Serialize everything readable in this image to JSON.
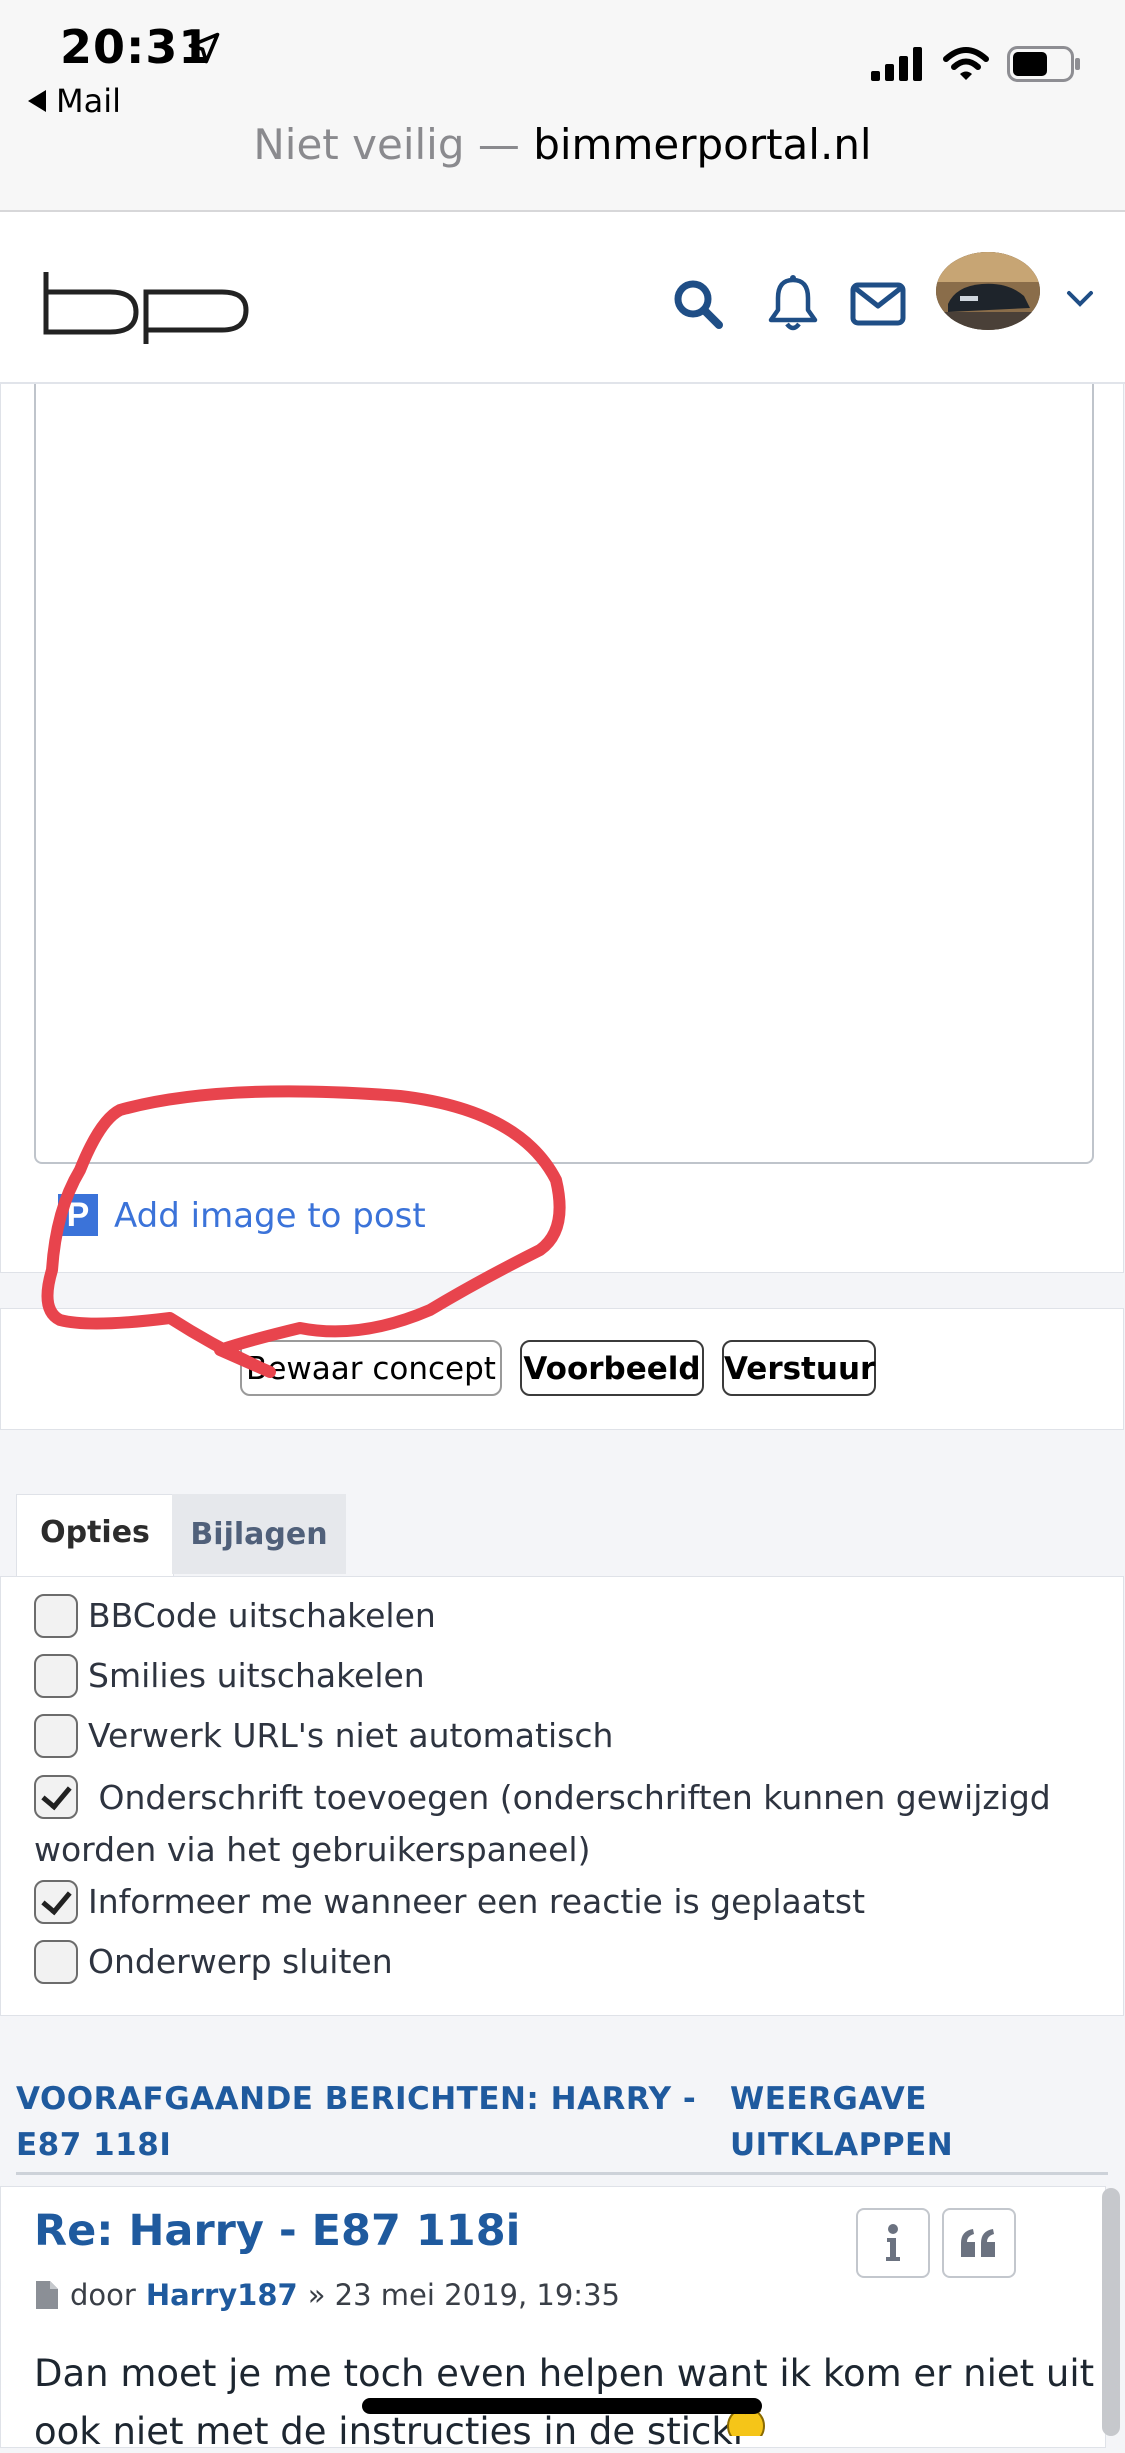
{
  "status_bar": {
    "time": "20:31",
    "back_label": "Mail"
  },
  "url_bar": {
    "not_secure": "Niet veilig —",
    "domain": "bimmerportal.nl"
  },
  "header": {
    "logo_icon": "bp-logo",
    "icons": [
      "search-icon",
      "bell-icon",
      "mail-icon"
    ],
    "accent": "#1f5a9e"
  },
  "editor": {
    "add_image_label": "Add image to post",
    "add_image_icon": "P"
  },
  "buttons": {
    "save_draft": "Bewaar concept",
    "preview": "Voorbeeld",
    "submit": "Verstuur"
  },
  "tabs": {
    "options": "Opties",
    "attachments": "Bijlagen"
  },
  "options": [
    {
      "label": "BBCode uitschakelen",
      "checked": false
    },
    {
      "label": "Smilies uitschakelen",
      "checked": false
    },
    {
      "label": "Verwerk URL's niet automatisch",
      "checked": false
    },
    {
      "label": "Onderschrift toevoegen (onderschriften kunnen gewijzigd worden via het gebruikerspaneel)",
      "checked": true
    },
    {
      "label": "Informeer me wanneer een reactie is geplaatst",
      "checked": true
    },
    {
      "label": "Onderwerp sluiten",
      "checked": false
    }
  ],
  "previous": {
    "title": "VOORAFGAANDE BERICHTEN: HARRY - E87 118I",
    "expand": "WEERGAVE UITKLAPPEN",
    "post": {
      "title": "Re: Harry - E87 118i",
      "by": "door",
      "author": "Harry187",
      "date": "» 23 mei 2019, 19:35",
      "body_line1": "Dan moet je me toch even helpen want ik kom er niet uit,",
      "body_line2": "ook niet met de instructies in de stickl"
    }
  },
  "annotation_color": "#e8444d"
}
